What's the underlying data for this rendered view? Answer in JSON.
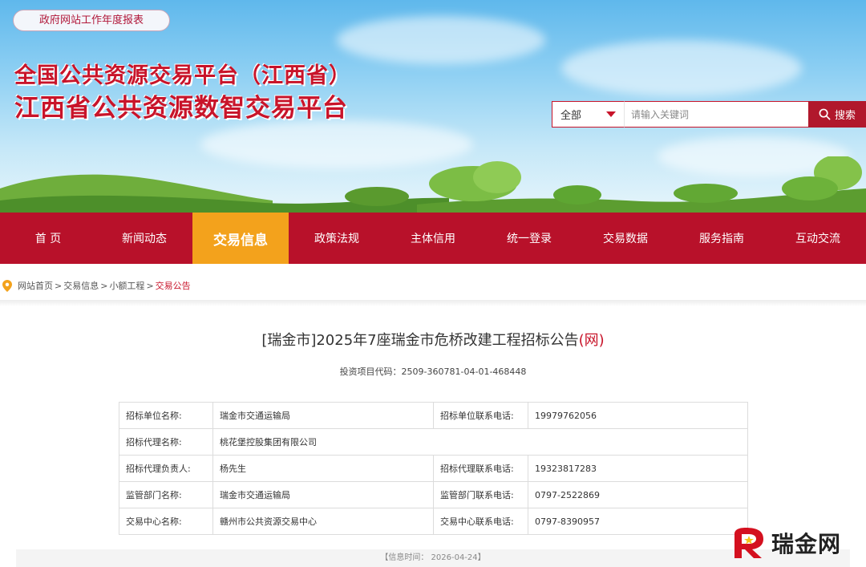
{
  "header": {
    "report_link": "政府网站工作年度报表",
    "title_line1": "全国公共资源交易平台（江西省）",
    "title_line2": "江西省公共资源数智交易平台"
  },
  "search": {
    "category": "全部",
    "placeholder": "请输入关键词",
    "button_label": "搜索"
  },
  "nav": {
    "items": [
      {
        "label": "首 页"
      },
      {
        "label": "新闻动态"
      },
      {
        "label": "交易信息"
      },
      {
        "label": "政策法规"
      },
      {
        "label": "主体信用"
      },
      {
        "label": "统一登录"
      },
      {
        "label": "交易数据"
      },
      {
        "label": "服务指南"
      },
      {
        "label": "互动交流"
      }
    ],
    "active_index": 2
  },
  "breadcrumb": {
    "items": [
      "网站首页",
      "交易信息",
      "小额工程",
      "交易公告"
    ],
    "separators": [
      ">",
      ">",
      ">"
    ]
  },
  "article": {
    "title": "[瑞金市]2025年7座瑞金市危桥改建工程招标公告",
    "title_suffix": "(网)",
    "project_code": "投资项目代码：2509-360781-04-01-468448",
    "rows": [
      {
        "k1": "招标单位名称:",
        "v1": "瑞金市交通运输局",
        "k2": "招标单位联系电话:",
        "v2": "19979762056"
      },
      {
        "k1": "招标代理名称:",
        "v1": "桃花堡控股集团有限公司"
      },
      {
        "k1": "招标代理负责人:",
        "v1": "杨先生",
        "k2": "招标代理联系电话:",
        "v2": "19323817283"
      },
      {
        "k1": "监管部门名称:",
        "v1": "瑞金市交通运输局",
        "k2": "监管部门联系电话:",
        "v2": "0797-2522869"
      },
      {
        "k1": "交易中心名称:",
        "v1": "赣州市公共资源交易中心",
        "k2": "交易中心联系电话:",
        "v2": "0797-8390957"
      }
    ],
    "info_time": "【信息时间： 2026-04-24】"
  },
  "watermark": {
    "text": "瑞金网"
  },
  "colors": {
    "brand_red": "#b8112a",
    "active_orange": "#f3a21c"
  }
}
